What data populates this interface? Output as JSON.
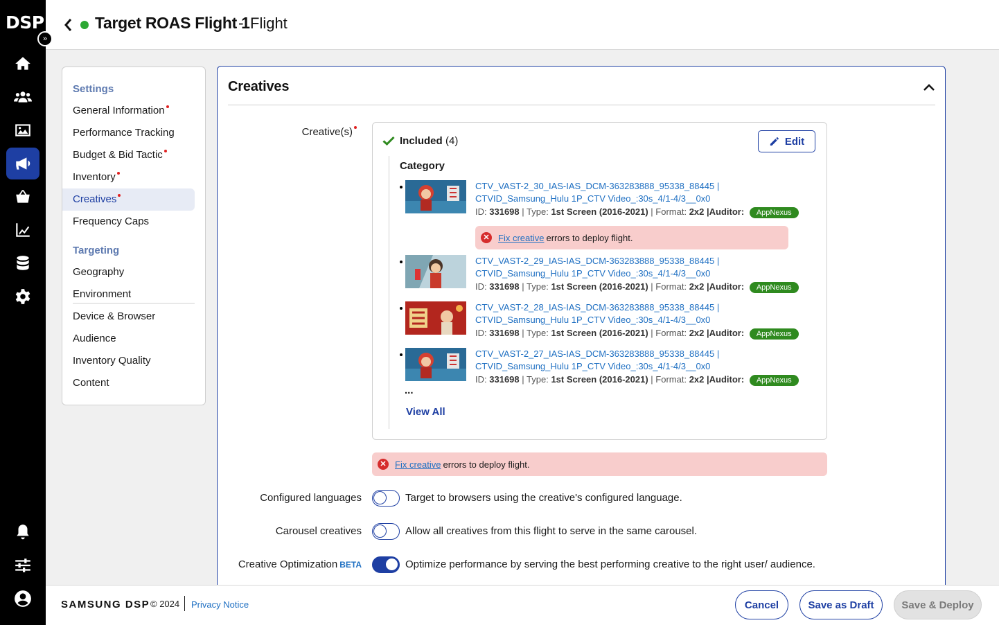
{
  "rail": {
    "logo": "DSP",
    "expand_icon": "double-chevron-right-icon",
    "items": [
      "home-icon",
      "audience-icon",
      "creative-image-icon",
      "campaign-megaphone-icon",
      "marketplace-basket-icon",
      "reports-chart-icon",
      "data-database-icon",
      "settings-gear-icon"
    ],
    "bottom_items": [
      "notifications-bell-icon",
      "preferences-sliders-icon",
      "user-avatar-icon"
    ],
    "active_item": "campaign-megaphone-icon"
  },
  "header": {
    "title": "Target ROAS Flight 1",
    "separator": "-",
    "subtitle": "Flight",
    "status_color": "#2da834"
  },
  "sidemenu": {
    "settings_label": "Settings",
    "settings_items": [
      {
        "label": "General Information",
        "required": true
      },
      {
        "label": "Performance Tracking",
        "required": false
      },
      {
        "label": "Budget & Bid Tactic",
        "required": true
      },
      {
        "label": "Inventory",
        "required": true
      },
      {
        "label": "Creatives",
        "required": true,
        "active": true
      },
      {
        "label": "Frequency Caps",
        "required": false
      }
    ],
    "targeting_label": "Targeting",
    "targeting_items": [
      "Geography",
      "Environment",
      "Device & Browser",
      "Audience",
      "Inventory Quality",
      "Content"
    ]
  },
  "panel": {
    "title": "Creatives",
    "creatives_label": "Creative(s)",
    "included_label": "Included",
    "included_count": "(4)",
    "edit_label": "Edit",
    "category_label": "Category",
    "creatives": [
      {
        "name": "CTV_VAST-2_30_IAS-IAS_DCM-363283888_95338_88445 | CTVID_Samsung_Hulu 1P_CTV Video_:30s_4/1-4/3__0x0",
        "id_label": "ID:",
        "id": "331698",
        "type_label": "| Type:",
        "type": "1st Screen (2016-2021)",
        "format_label": "| Format:",
        "format": "2x2",
        "auditor_label": "|Auditor:",
        "auditor": "AppNexus",
        "error": true
      },
      {
        "name": "CTV_VAST-2_29_IAS-IAS_DCM-363283888_95338_88445 | CTVID_Samsung_Hulu 1P_CTV Video_:30s_4/1-4/3__0x0",
        "id_label": "ID:",
        "id": "331698",
        "type_label": "| Type:",
        "type": "1st Screen (2016-2021)",
        "format_label": "| Format:",
        "format": "2x2",
        "auditor_label": "|Auditor:",
        "auditor": "AppNexus",
        "error": false
      },
      {
        "name": "CTV_VAST-2_28_IAS-IAS_DCM-363283888_95338_88445 | CTVID_Samsung_Hulu 1P_CTV Video_:30s_4/1-4/3__0x0",
        "id_label": "ID:",
        "id": "331698",
        "type_label": "| Type:",
        "type": "1st Screen (2016-2021)",
        "format_label": "| Format:",
        "format": "2x2",
        "auditor_label": "|Auditor:",
        "auditor": "AppNexus",
        "error": false
      },
      {
        "name": "CTV_VAST-2_27_IAS-IAS_DCM-363283888_95338_88445 | CTVID_Samsung_Hulu 1P_CTV Video_:30s_4/1-4/3__0x0",
        "id_label": "ID:",
        "id": "331698",
        "type_label": "| Type:",
        "type": "1st Screen (2016-2021)",
        "format_label": "| Format:",
        "format": "2x2",
        "auditor_label": "|Auditor:",
        "auditor": "AppNexus",
        "error": false
      }
    ],
    "ellipsis": "...",
    "view_all": "View All",
    "error_link": "Fix creative",
    "error_text": "errors to deploy flight.",
    "options": [
      {
        "label": "Configured languages",
        "description": "Target to browsers using the creative's configured language.",
        "enabled": false
      },
      {
        "label": "Carousel creatives",
        "description": "Allow all creatives from this flight to serve in the same carousel.",
        "enabled": false
      },
      {
        "label": "Creative Optimization",
        "badge": "BETA",
        "description": "Optimize performance by serving the best performing creative to the right user/ audience.",
        "enabled": true
      }
    ]
  },
  "footer": {
    "brand": "SAMSUNG DSP",
    "copyright": "© 2024",
    "privacy": "Privacy Notice",
    "cancel": "Cancel",
    "save_draft": "Save as Draft",
    "save_deploy": "Save & Deploy"
  },
  "colors": {
    "accent": "#1e3fa3",
    "link": "#1e6fc2",
    "error_bg": "#f8cdcc",
    "auditor_badge": "#2f8a1f"
  }
}
